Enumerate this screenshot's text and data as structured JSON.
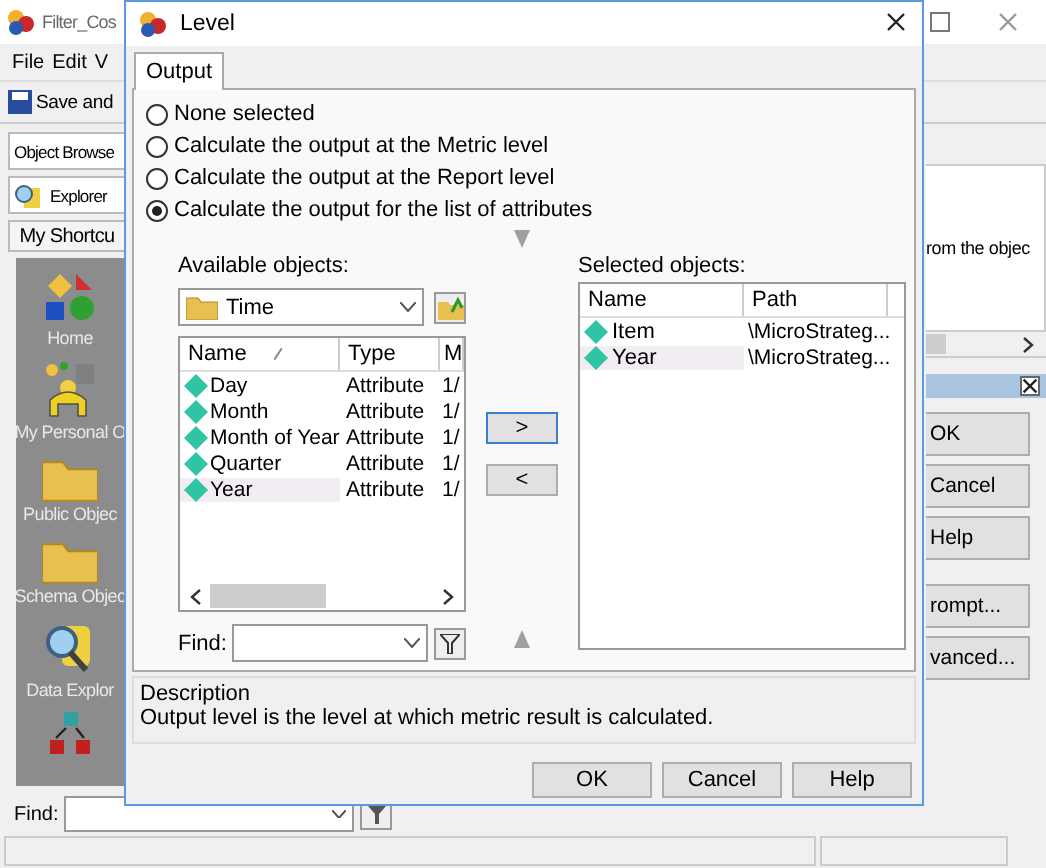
{
  "main_window": {
    "title": "Filter_Cos",
    "menu": [
      {
        "label": "File"
      },
      {
        "label": "Edit"
      },
      {
        "label": "V"
      }
    ],
    "toolbar": {
      "save_label": "Save and"
    },
    "object_browser": "Object Browse",
    "explorer": "Explorer",
    "shortcuts_header": "My Shortcu",
    "shortcuts": [
      {
        "kind": "home",
        "label": "Home"
      },
      {
        "kind": "person",
        "label": "My Personal O"
      },
      {
        "kind": "folder",
        "label": "Public Objec"
      },
      {
        "kind": "folder",
        "label": "Schema Objec"
      },
      {
        "kind": "data",
        "label": "Data Explor"
      },
      {
        "kind": "schema"
      }
    ],
    "find_label": "Find:",
    "panel_text": "rom the objec",
    "buttons": [
      "OK",
      "Cancel",
      "Help",
      "rompt...",
      "vanced..."
    ]
  },
  "dialog": {
    "title": "Level",
    "tabs": [
      {
        "label": "Output",
        "selected": true
      }
    ],
    "options": [
      {
        "label": "None selected",
        "selected": false
      },
      {
        "label": "Calculate the output at the Metric level",
        "selected": false
      },
      {
        "label": "Calculate the output at the Report level",
        "selected": false
      },
      {
        "label": "Calculate the output for the list of attributes",
        "selected": true
      }
    ],
    "available": {
      "label": "Available objects:",
      "folder": "Time",
      "columns": [
        "Name",
        "Type",
        "M"
      ],
      "rows": [
        {
          "name": "Day",
          "type": "Attribute",
          "column_3": "1/",
          "selected": false
        },
        {
          "name": "Month",
          "type": "Attribute",
          "column_3": "1/",
          "selected": false
        },
        {
          "name": "Month of Year",
          "type": "Attribute",
          "column_3": "1/",
          "selected": false
        },
        {
          "name": "Quarter",
          "type": "Attribute",
          "column_3": "1/",
          "selected": false
        },
        {
          "name": "Year",
          "type": "Attribute",
          "column_3": "1/",
          "selected": true
        }
      ]
    },
    "find_label": "Find:",
    "add_button": ">",
    "remove_button": "<",
    "selected_objects": {
      "label": "Selected objects:",
      "columns": [
        "Name",
        "Path"
      ],
      "rows": [
        {
          "name": "Item",
          "path": "\\MicroStrateg...",
          "selected": false
        },
        {
          "name": "Year",
          "path": "\\MicroStrateg...",
          "selected": true
        }
      ]
    },
    "description": {
      "title": "Description",
      "text": "Output level is the level at which metric result is calculated."
    },
    "buttons": [
      "OK",
      "Cancel",
      "Help"
    ]
  }
}
